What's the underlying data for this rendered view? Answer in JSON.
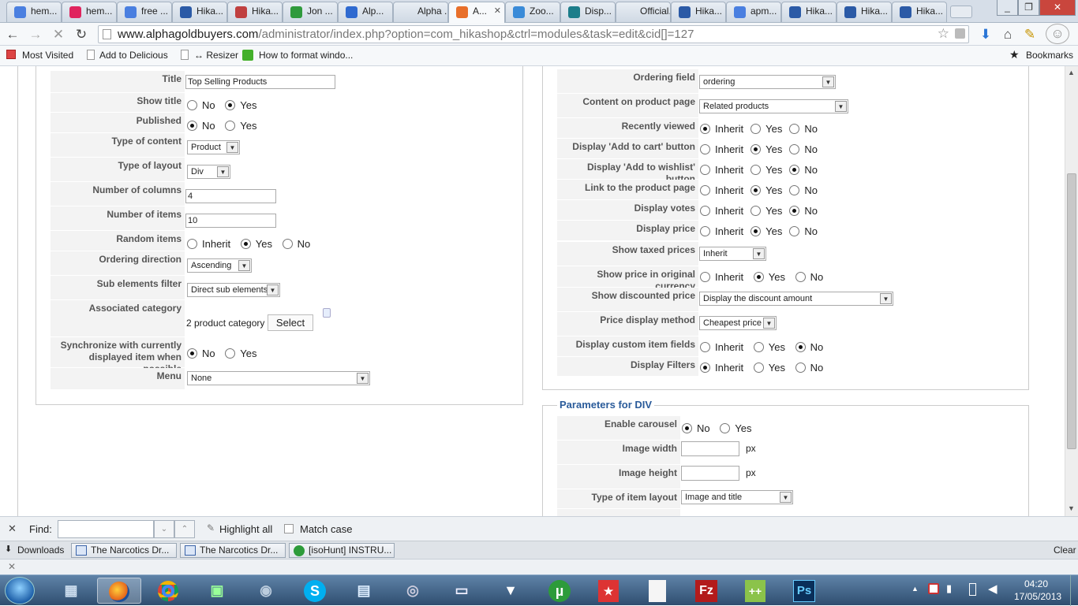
{
  "browser": {
    "tabs": [
      {
        "label": "hem...",
        "icon": "google-icon",
        "color": "#4a7fe0"
      },
      {
        "label": "hem...",
        "icon": "flickr-icon",
        "color": "#e0245e"
      },
      {
        "label": "free ...",
        "icon": "google-icon",
        "color": "#4a7fe0"
      },
      {
        "label": "Hika...",
        "icon": "hikashop-icon",
        "color": "#2b5aa6"
      },
      {
        "label": "Hika...",
        "icon": "page-icon",
        "color": "#c04040"
      },
      {
        "label": "Jon ...",
        "icon": "green-icon",
        "color": "#2f9a3c"
      },
      {
        "label": "Alp...",
        "icon": "moon-icon",
        "color": "#2f6ad0"
      },
      {
        "label": "Alpha ...",
        "icon": "",
        "color": ""
      },
      {
        "label": "A...",
        "icon": "joomla-icon",
        "color": "#e86f2a"
      },
      {
        "label": "Zoo...",
        "icon": "joomla-icon",
        "color": "#3a8bd8"
      },
      {
        "label": "Disp...",
        "icon": "snowflake-icon",
        "color": "#1c7d8a"
      },
      {
        "label": "Official...",
        "icon": "",
        "color": ""
      },
      {
        "label": "Hika...",
        "icon": "hikashop-icon",
        "color": "#2b5aa6"
      },
      {
        "label": "apm...",
        "icon": "google-icon",
        "color": "#4a7fe0"
      },
      {
        "label": "Hika...",
        "icon": "hikashop-icon",
        "color": "#2b5aa6"
      },
      {
        "label": "Hika...",
        "icon": "hikashop-icon",
        "color": "#2b5aa6"
      },
      {
        "label": "Hika...",
        "icon": "hikashop-icon",
        "color": "#2b5aa6"
      }
    ],
    "url_domain": "www.alphagoldbuyers.com",
    "url_path": "/administrator/index.php?option=com_hikashop&ctrl=modules&task=edit&cid[]=127",
    "bookmarks": [
      "Most Visited",
      "Add to Delicious",
      "↔ Resizer",
      "How to format windo..."
    ],
    "bookmarks_right": "Bookmarks"
  },
  "left_form": {
    "title_label": "Title",
    "title_value": "Top Selling Products",
    "show_title_label": "Show title",
    "published_label": "Published",
    "type_content_label": "Type of content",
    "type_content_value": "Product",
    "type_layout_label": "Type of layout",
    "type_layout_value": "Div",
    "num_columns_label": "Number of columns",
    "num_columns_value": "4",
    "num_items_label": "Number of items",
    "num_items_value": "10",
    "random_items_label": "Random items",
    "ordering_direction_label": "Ordering direction",
    "ordering_direction_value": "Ascending",
    "sub_elements_label": "Sub elements filter",
    "sub_elements_value": "Direct sub elements",
    "assoc_category_label": "Associated category",
    "assoc_category_value": "2 product category",
    "select_button": "Select",
    "sync_label": "Synchronize with currently displayed item when possible",
    "menu_label": "Menu",
    "menu_value": "None"
  },
  "options": {
    "no": "No",
    "yes": "Yes",
    "inherit": "Inherit"
  },
  "right_form": {
    "ordering_field_label": "Ordering field",
    "ordering_field_value": "ordering",
    "content_product_page_label": "Content on product page",
    "content_product_page_value": "Related products",
    "recently_viewed_label": "Recently viewed",
    "add_to_cart_label": "Display 'Add to cart' button",
    "add_to_wishlist_label": "Display 'Add to wishlist' button",
    "link_product_label": "Link to the product page",
    "display_votes_label": "Display votes",
    "display_price_label": "Display price",
    "show_taxed_label": "Show taxed prices",
    "show_taxed_value": "Inherit",
    "show_original_currency_label": "Show price in original currency",
    "show_discounted_label": "Show discounted price",
    "show_discounted_value": "Display the discount amount",
    "price_display_method_label": "Price display method",
    "price_display_method_value": "Cheapest price",
    "display_custom_fields_label": "Display custom item fields",
    "display_filters_label": "Display Filters"
  },
  "div_params": {
    "heading": "Parameters for DIV",
    "carousel_label": "Enable carousel",
    "image_width_label": "Image width",
    "image_height_label": "Image height",
    "px": "px",
    "item_layout_label": "Type of item layout",
    "item_layout_value": "Image and title"
  },
  "findbar": {
    "find_label": "Find:",
    "highlight_all": "Highlight all",
    "match_case": "Match case"
  },
  "downloads": {
    "label": "Downloads",
    "items": [
      "The Narcotics Dr...",
      "The Narcotics Dr...",
      "[isoHunt] INSTRU..."
    ],
    "clear": "Clear"
  },
  "taskbar": {
    "time": "04:20",
    "date": "17/05/2013"
  }
}
